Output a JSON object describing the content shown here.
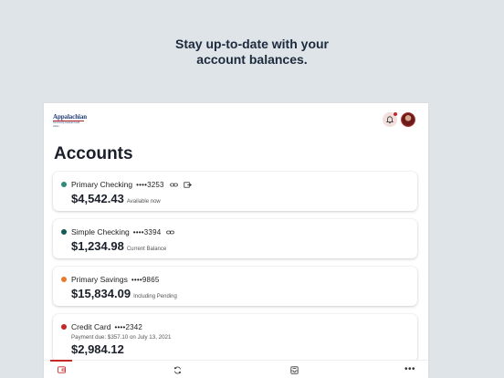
{
  "headline": {
    "line1": "Stay up-to-date with your",
    "line2": "account balances."
  },
  "app": {
    "logo_text": "Appalachian",
    "logo_subtext": "Community Federal Credit Union",
    "notification_dot_color": "#c62828"
  },
  "accounts": {
    "title": "Accounts",
    "items": [
      {
        "name": "Primary Checking",
        "mask": "••••3253",
        "balance": "$4,542.43",
        "note": "Available now",
        "dot_color": "#2e8b7a",
        "icons": [
          "link-icon",
          "transfer-icon"
        ]
      },
      {
        "name": "Simple Checking",
        "mask": "••••3394",
        "balance": "$1,234.98",
        "note": "Current Balance",
        "dot_color": "#0f5c57",
        "icons": [
          "link-icon"
        ]
      },
      {
        "name": "Primary Savings",
        "mask": "••••9865",
        "balance": "$15,834.09",
        "note": "Including Pending",
        "dot_color": "#e87a2e",
        "icons": []
      },
      {
        "name": "Credit Card",
        "mask": "••••2342",
        "due": "Payment due: $357.10 on July 13, 2021",
        "balance": "$2,984.12",
        "dot_color": "#c62828",
        "icons": []
      }
    ]
  },
  "tabbar": {
    "tabs": [
      "accounts-tab",
      "transfers-tab",
      "deposit-tab",
      "more-tab"
    ],
    "more_label": "•••",
    "active_color": "#c62828"
  }
}
